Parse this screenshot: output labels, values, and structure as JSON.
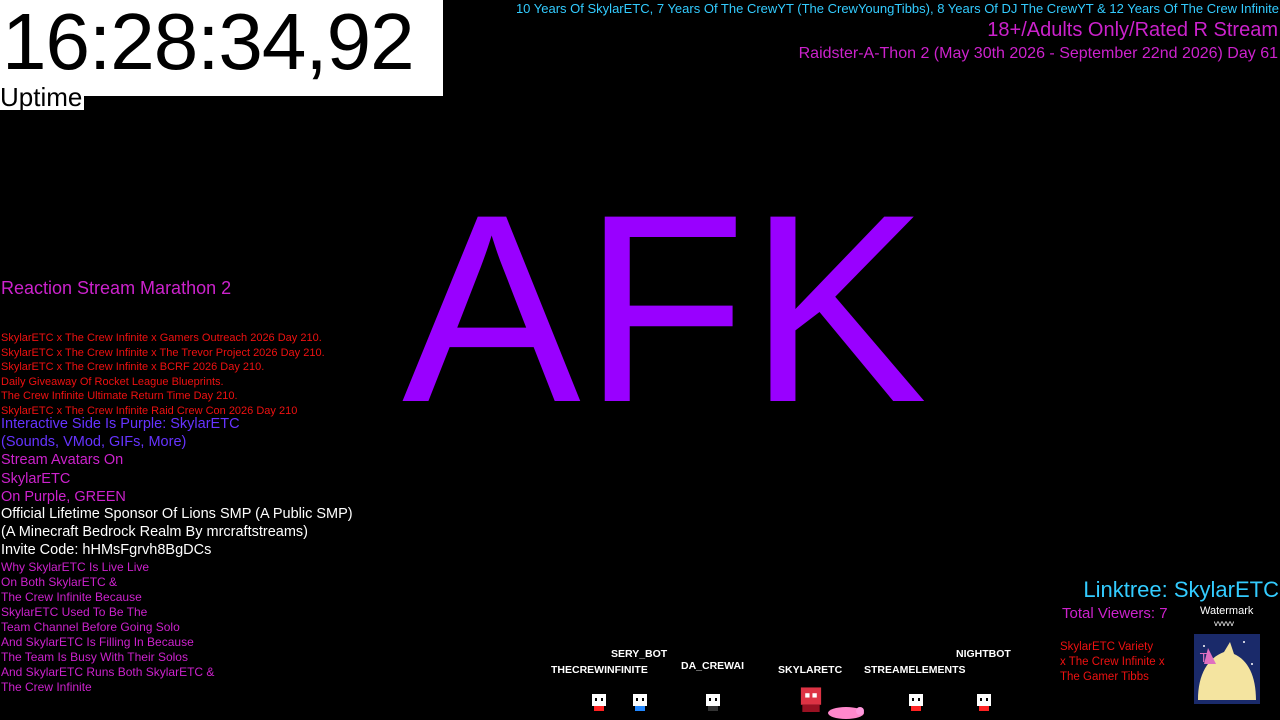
{
  "timer": {
    "clock": "16:28:34,92",
    "uptime_label": "Uptime"
  },
  "header": {
    "years_banner": "10 Years Of SkylarETC, 7 Years Of The CrewYT (The CrewYoungTibbs), 8 Years Of DJ The CrewYT & 12 Years Of The Crew Infinite",
    "rating": "18+/Adults Only/Rated R Stream",
    "thon": "Raidster-A-Thon 2 (May 30th 2026 - September 22nd 2026) Day 61"
  },
  "status": {
    "afk": "AFK"
  },
  "left_panel": {
    "marathon": "Reaction Stream Marathon 2",
    "red_lines": [
      "SkylarETC x The Crew Infinite x Gamers Outreach 2026 Day 210.",
      "SkylarETC x The Crew Infinite x The Trevor Project 2026 Day 210.",
      "SkylarETC x The Crew Infinite x BCRF 2026 Day 210.",
      "Daily Giveaway Of Rocket League Blueprints.",
      "The Crew Infinite Ultimate Return Time Day 210.",
      "SkylarETC x The Crew Infinite Raid Crew Con 2026 Day 210"
    ],
    "interactive": [
      "Interactive Side Is Purple: SkylarETC",
      "(Sounds, VMod, GIFs, More)"
    ],
    "avatars": [
      "Stream Avatars On",
      "SkylarETC",
      "On Purple, GREEN"
    ],
    "lions": [
      "Official Lifetime Sponsor Of Lions SMP (A Public SMP)",
      "(A Minecraft Bedrock Realm By mrcraftstreams)",
      "Invite Code: hHMsFgrvh8BgDCs"
    ],
    "why": [
      "Why SkylarETC Is Live Live",
      "On Both SkylarETC &",
      "The Crew Infinite Because",
      "SkylarETC Used To Be The",
      "Team Channel Before Going Solo",
      "And SkylarETC Is Filling In Because",
      "The Team Is Busy With Their Solos",
      "And SkylarETC Runs Both SkylarETC &",
      "The Crew Infinite"
    ]
  },
  "right_panel": {
    "linktree": "Linktree: SkylarETC",
    "viewers": "Total Viewers: 7",
    "variety": [
      "SkylarETC Variety",
      "x The Crew Infinite x",
      "The Gamer Tibbs"
    ],
    "watermark_label": "Watermark",
    "watermark_sub": "vvvvv"
  },
  "chatters": [
    {
      "name": "SERY_BOT",
      "avatar_color": "#ffffff",
      "accent": "#ff2222"
    },
    {
      "name": "THECREWINFINITE",
      "avatar_color": "#ffffff",
      "accent": "#ff2222"
    },
    {
      "name": "DA_CREWAI",
      "avatar_color": "#ffffff",
      "accent": "#222222"
    },
    {
      "name": "SKYLARETC",
      "avatar_color": "#dd3344",
      "accent": "#ff88cc"
    },
    {
      "name": "STREAMELEMENTS",
      "avatar_color": "#ffffff",
      "accent": "#ff2222"
    },
    {
      "name": "NIGHTBOT",
      "avatar_color": "#ffffff",
      "accent": "#ff2222"
    }
  ],
  "colors": {
    "cyan": "#33ccff",
    "magenta": "#cc22cc",
    "purple": "#9900ff",
    "red": "#ee1111",
    "violet": "#6633ff",
    "white": "#ffffff",
    "background": "#000000"
  }
}
